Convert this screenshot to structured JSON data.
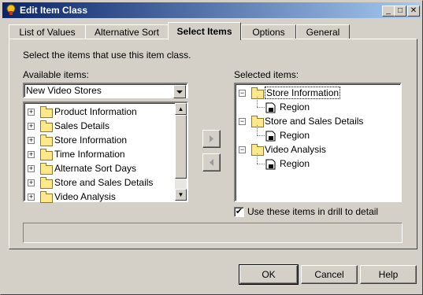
{
  "window": {
    "title": "Edit Item Class"
  },
  "tabs": [
    {
      "label": "List of Values"
    },
    {
      "label": "Alternative Sort"
    },
    {
      "label": "Select Items"
    },
    {
      "label": "Options"
    },
    {
      "label": "General"
    }
  ],
  "panel": {
    "instruction": "Select the items that use this item class.",
    "available_label": "Available items:",
    "selected_label": "Selected items:",
    "combo_value": "New Video Stores",
    "available_items": [
      {
        "label": "Product Information",
        "icon": "folder-icon"
      },
      {
        "label": "Sales Details",
        "icon": "folder-icon"
      },
      {
        "label": "Store Information",
        "icon": "folder-icon"
      },
      {
        "label": "Time Information",
        "icon": "folder-icon"
      },
      {
        "label": "Alternate Sort Days",
        "icon": "sql-folder-icon"
      },
      {
        "label": "Store and Sales Details",
        "icon": "complex-folder-icon"
      },
      {
        "label": "Video Analysis",
        "icon": "complex-folder-icon"
      }
    ],
    "selected_items": [
      {
        "label": "Store Information",
        "children": [
          "Region"
        ]
      },
      {
        "label": "Store and Sales Details",
        "children": [
          "Region"
        ]
      },
      {
        "label": "Video Analysis",
        "children": [
          "Region"
        ]
      }
    ],
    "drill_checkbox": {
      "label": "Use these items in drill to detail",
      "checked": true
    }
  },
  "buttons": {
    "ok": "OK",
    "cancel": "Cancel",
    "help": "Help"
  },
  "colors": {
    "title_start": "#0a246a",
    "title_end": "#a6caf0",
    "face": "#d4d0c8",
    "selection": "#0a246a"
  }
}
